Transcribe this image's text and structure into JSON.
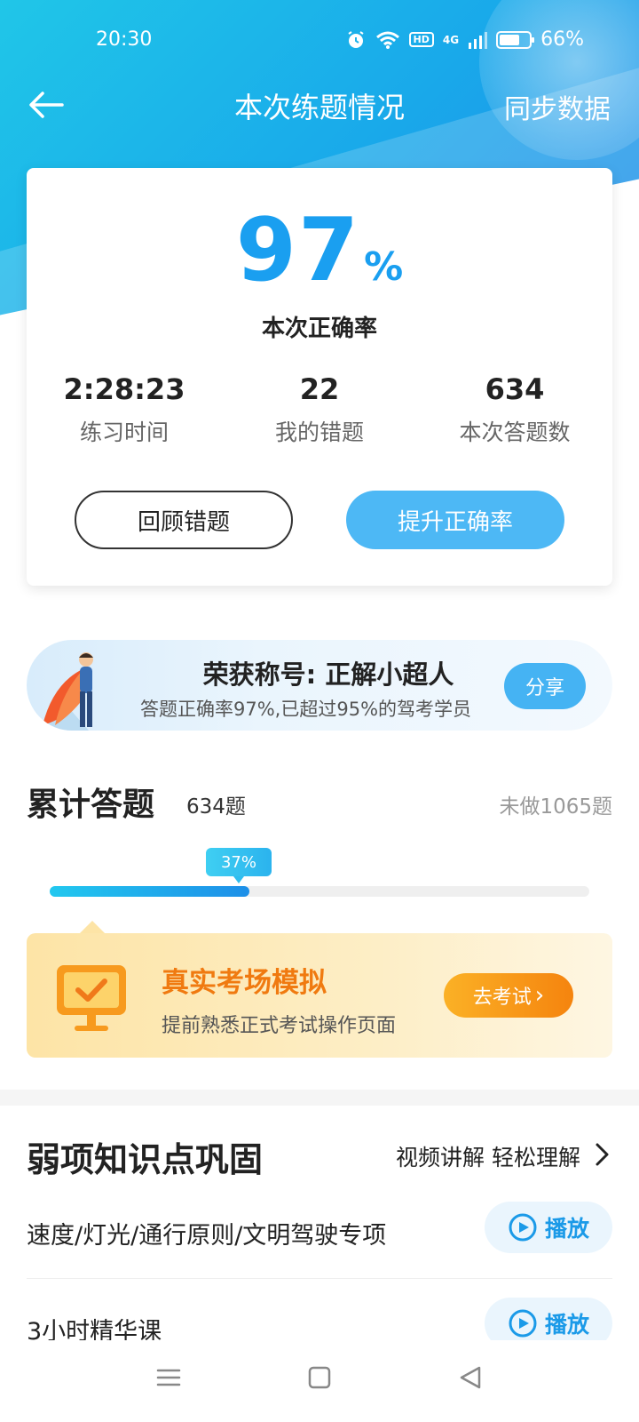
{
  "status_bar": {
    "time": "20:30",
    "battery_percent_text": "66%",
    "icons": [
      "alarm-icon",
      "wifi-icon",
      "hd-icon",
      "4g-signal-icon",
      "battery-icon"
    ],
    "hd_label": "HD",
    "net_label": "4G"
  },
  "nav": {
    "title": "本次练题情况",
    "sync_label": "同步数据"
  },
  "result": {
    "accuracy_value": "97",
    "accuracy_sign": "%",
    "accuracy_label": "本次正确率",
    "stats": [
      {
        "value": "2:28:23",
        "label": "练习时间"
      },
      {
        "value": "22",
        "label": "我的错题"
      },
      {
        "value": "634",
        "label": "本次答题数"
      }
    ],
    "review_button": "回顾错题",
    "improve_button": "提升正确率"
  },
  "honor": {
    "title": "荣获称号: 正解小超人",
    "subtitle": "答题正确率97%,已超过95%的驾考学员",
    "share_label": "分享"
  },
  "cumulative": {
    "title": "累计答题",
    "count_text": "634题",
    "remaining_text": "未做1065题",
    "progress_label": "37%",
    "progress_fraction": 0.37
  },
  "exam": {
    "title": "真实考场模拟",
    "subtitle": "提前熟悉正式考试操作页面",
    "go_label": "去考试",
    "go_chevron": "›"
  },
  "weak": {
    "title": "弱项知识点巩固",
    "link_label": "视频讲解 轻松理解",
    "items": [
      {
        "name": "速度/灯光/通行原则/文明驾驶专项",
        "play_label": "播放"
      },
      {
        "name": "3小时精华课",
        "play_label": "播放"
      }
    ]
  },
  "colors": {
    "brand_blue": "#1a9ff0",
    "accent_orange": "#f07a10",
    "button_blue": "#4db8f5"
  }
}
